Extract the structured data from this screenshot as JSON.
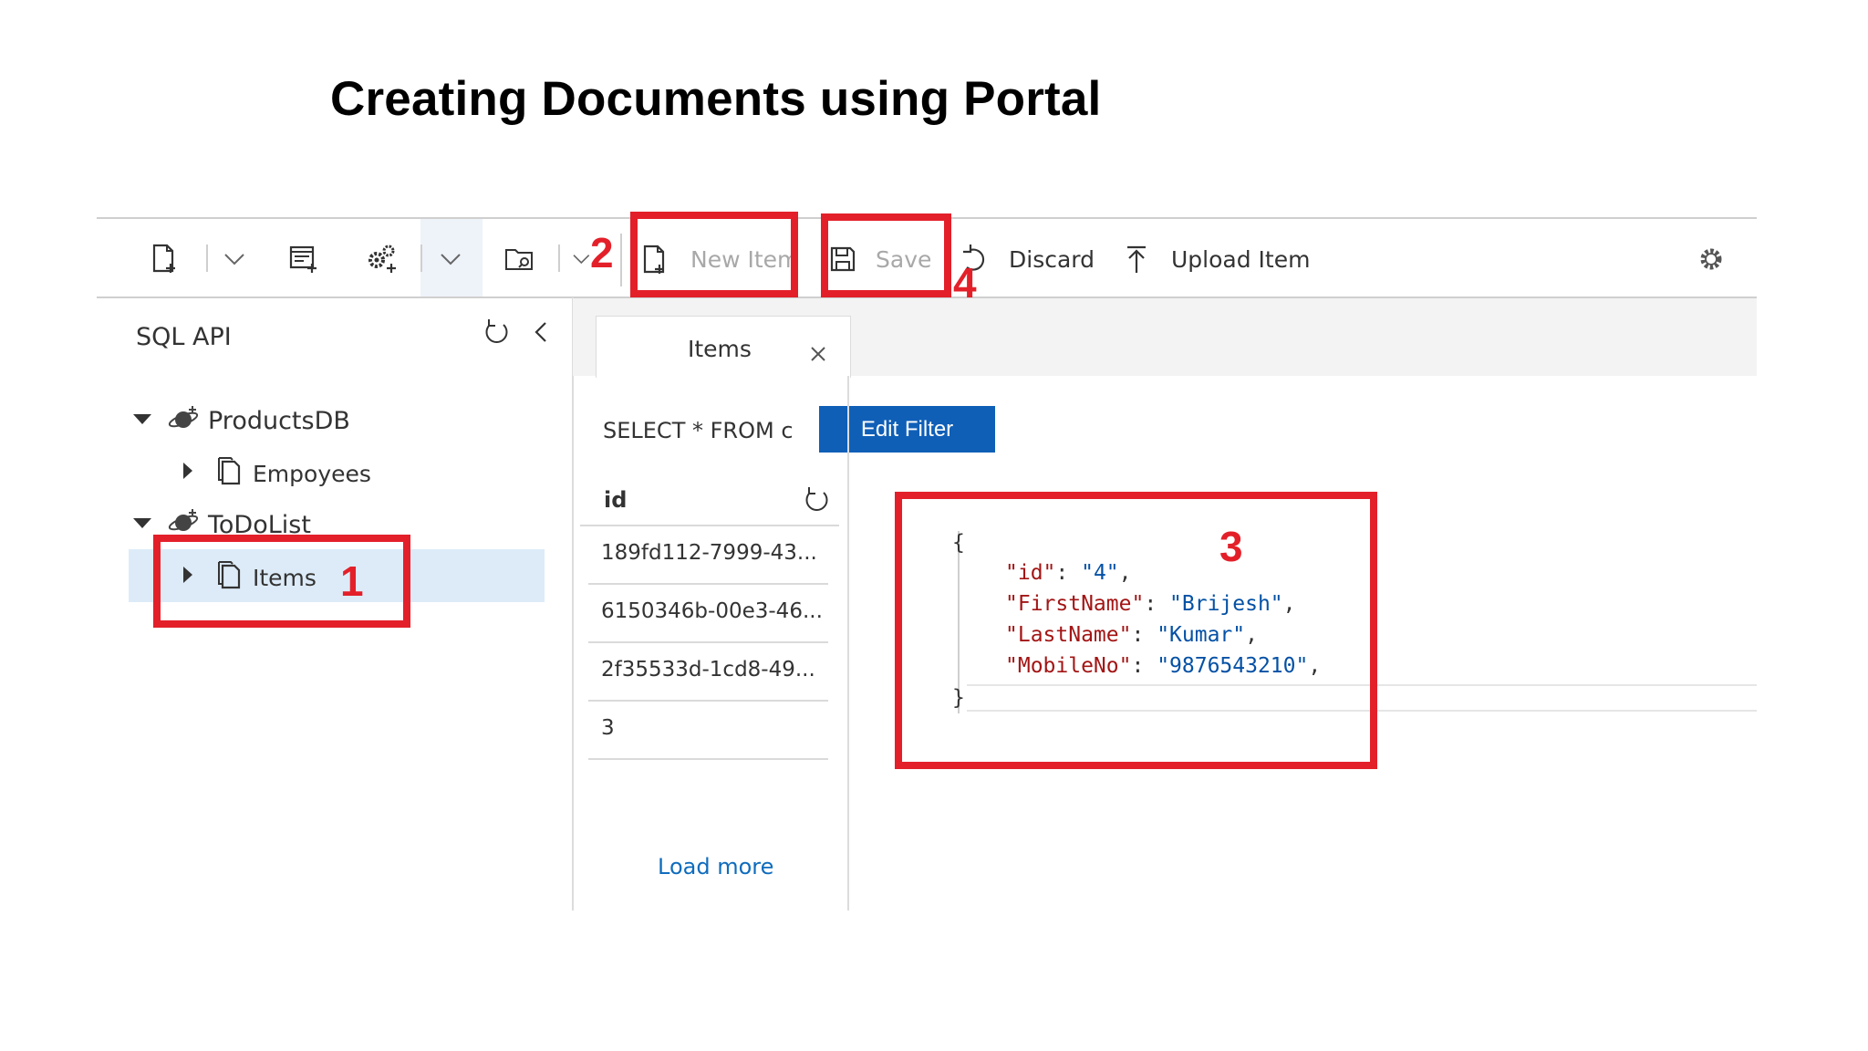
{
  "slide": {
    "title": "Creating Documents using Portal"
  },
  "toolbar": {
    "new_item_label": "New Item",
    "save_label": "Save",
    "discard_label": "Discard",
    "upload_label": "Upload Item"
  },
  "sidebar": {
    "title": "SQL API",
    "databases": [
      {
        "label": "ProductsDB",
        "containers": [
          {
            "label": "Empoyees"
          }
        ]
      },
      {
        "label": "ToDoList",
        "containers": [
          {
            "label": "Items"
          }
        ]
      }
    ]
  },
  "tab": {
    "label": "Items"
  },
  "query": {
    "text": "SELECT * FROM c",
    "filter_button": "Edit Filter"
  },
  "table": {
    "column": "id",
    "rows": [
      "189fd112-7999-43...",
      "6150346b-00e3-46...",
      "2f35533d-1cd8-49...",
      "3"
    ],
    "load_more": "Load more"
  },
  "editor": {
    "open_brace": "{",
    "close_brace": "}",
    "fields": [
      {
        "key": "\"id\"",
        "value": "\"4\""
      },
      {
        "key": "\"FirstName\"",
        "value": "\"Brijesh\""
      },
      {
        "key": "\"LastName\"",
        "value": "\"Kumar\""
      },
      {
        "key": "\"MobileNo\"",
        "value": "\"9876543210\""
      }
    ]
  },
  "annotations": {
    "step1": "1",
    "step2": "2",
    "step3": "3",
    "step4": "4"
  },
  "colors": {
    "annotation_red": "#e3202a",
    "accent_blue": "#0f5fb7",
    "selection": "#ddebf8"
  }
}
